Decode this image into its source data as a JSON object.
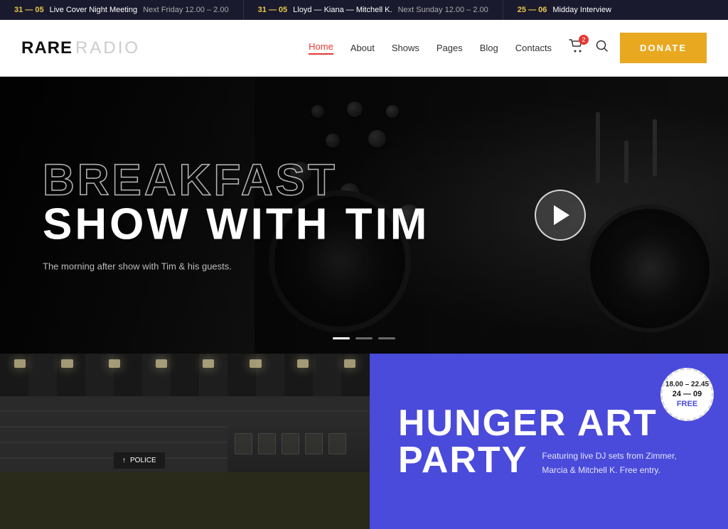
{
  "ticker": {
    "items": [
      {
        "date": "31 — 05",
        "title": "Live Cover Night Meeting",
        "time": "Next Friday 12.00 – 2.00"
      },
      {
        "date": "31 — 05",
        "title": "Lloyd — Kiana — Mitchell K.",
        "time": "Next Sunday 12.00 – 2.00"
      },
      {
        "date": "25 — 06",
        "title": "Midday Interview",
        "time": ""
      }
    ]
  },
  "header": {
    "logo_rare": "RARE",
    "logo_radio": "RADIO",
    "nav": [
      {
        "label": "Home",
        "active": true
      },
      {
        "label": "About",
        "active": false
      },
      {
        "label": "Shows",
        "active": false
      },
      {
        "label": "Pages",
        "active": false
      },
      {
        "label": "Blog",
        "active": false
      },
      {
        "label": "Contacts",
        "active": false
      }
    ],
    "cart_count": "2",
    "donate_label": "DONATE"
  },
  "hero": {
    "title_line1": "BREAKFAST",
    "title_line2": "SHOW WITH TIM",
    "subtitle": "The morning after show with Tim & his guests.",
    "dots": [
      {
        "active": true
      },
      {
        "active": false
      },
      {
        "active": false
      }
    ]
  },
  "event": {
    "badge_time": "18.00 – 22.45",
    "badge_date": "24 — 09",
    "badge_free": "FREE",
    "title_line1": "HUNGER ART",
    "title_line2": "PARTY",
    "description": "Featuring live DJ sets from Zimmer, Marcia & Mitchell K. Free entry."
  },
  "subway": {
    "sign_text": "POLICE",
    "sign_arrow": "↑"
  }
}
